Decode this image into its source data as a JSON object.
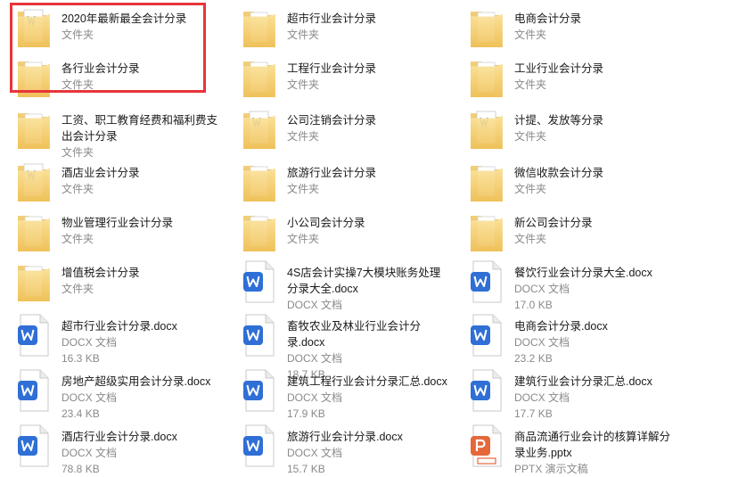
{
  "colors": {
    "highlight": "#e8343a",
    "folder": "#f4ce72",
    "doc_blue": "#2f6fd6",
    "ppt_orange": "#e5683a"
  },
  "items": [
    {
      "name": "2020年最新最全会计分录",
      "type": "文件夹",
      "icon": "folder-doc-icon"
    },
    {
      "name": "超市行业会计分录",
      "type": "文件夹",
      "icon": "folder-icon"
    },
    {
      "name": "电商会计分录",
      "type": "文件夹",
      "icon": "folder-icon"
    },
    {
      "name": "各行业会计分录",
      "type": "文件夹",
      "icon": "folder-icon"
    },
    {
      "name": "工程行业会计分录",
      "type": "文件夹",
      "icon": "folder-icon"
    },
    {
      "name": "工业行业会计分录",
      "type": "文件夹",
      "icon": "folder-icon"
    },
    {
      "name": "工资、职工教育经费和福利费支出会计分录",
      "type": "文件夹",
      "icon": "folder-icon"
    },
    {
      "name": "公司注销会计分录",
      "type": "文件夹",
      "icon": "folder-doc-icon"
    },
    {
      "name": "计提、发放等分录",
      "type": "文件夹",
      "icon": "folder-doc-icon"
    },
    {
      "name": "酒店业会计分录",
      "type": "文件夹",
      "icon": "folder-doc-icon"
    },
    {
      "name": "旅游行业会计分录",
      "type": "文件夹",
      "icon": "folder-icon"
    },
    {
      "name": "微信收款会计分录",
      "type": "文件夹",
      "icon": "folder-icon"
    },
    {
      "name": "物业管理行业会计分录",
      "type": "文件夹",
      "icon": "folder-icon"
    },
    {
      "name": "小公司会计分录",
      "type": "文件夹",
      "icon": "folder-icon"
    },
    {
      "name": "新公司会计分录",
      "type": "文件夹",
      "icon": "folder-icon"
    },
    {
      "name": "增值税会计分录",
      "type": "文件夹",
      "icon": "folder-icon"
    },
    {
      "name": "4S店会计实操7大模块账务处理分录大全.docx",
      "type": "DOCX 文档",
      "icon": "word-doc-icon"
    },
    {
      "name": "餐饮行业会计分录大全.docx",
      "type": "DOCX 文档",
      "size": "17.0 KB",
      "icon": "word-doc-icon"
    },
    {
      "name": "超市行业会计分录.docx",
      "type": "DOCX 文档",
      "size": "16.3 KB",
      "icon": "word-doc-icon"
    },
    {
      "name": "畜牧农业及林业行业会计分录.docx",
      "type": "DOCX 文档",
      "size": "18.7 KB",
      "icon": "word-doc-icon"
    },
    {
      "name": "电商会计分录.docx",
      "type": "DOCX 文档",
      "size": "23.2 KB",
      "icon": "word-doc-icon"
    },
    {
      "name": "房地产超级实用会计分录.docx",
      "type": "DOCX 文档",
      "size": "23.4 KB",
      "icon": "word-doc-icon"
    },
    {
      "name": "建筑工程行业会计分录汇总.docx",
      "type": "DOCX 文档",
      "size": "17.9 KB",
      "icon": "word-doc-icon"
    },
    {
      "name": "建筑行业会计分录汇总.docx",
      "type": "DOCX 文档",
      "size": "17.7 KB",
      "icon": "word-doc-icon"
    },
    {
      "name": "酒店行业会计分录.docx",
      "type": "DOCX 文档",
      "size": "78.8 KB",
      "icon": "word-doc-icon"
    },
    {
      "name": "旅游行业会计分录.docx",
      "type": "DOCX 文档",
      "size": "15.7 KB",
      "icon": "word-doc-icon"
    },
    {
      "name": "商品流通行业会计的核算详解分录业务.pptx",
      "type": "PPTX 演示文稿",
      "icon": "ppt-doc-icon"
    }
  ]
}
